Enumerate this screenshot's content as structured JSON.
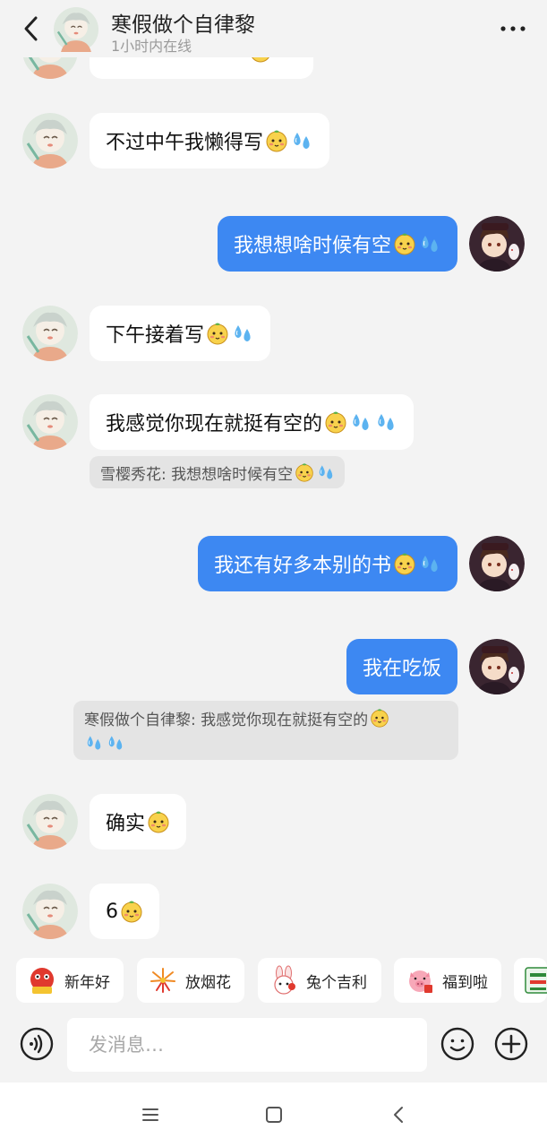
{
  "header": {
    "title": "寒假做个自律黎",
    "status": "1小时内在线"
  },
  "messages": [
    {
      "side": "in",
      "text": "",
      "emojis": [
        "face"
      ]
    },
    {
      "side": "in",
      "text": "不过中午我懒得写",
      "emojis": [
        "face",
        "sweat"
      ]
    },
    {
      "side": "out",
      "text": "我想想啥时候有空",
      "emojis": [
        "face",
        "sweat"
      ]
    },
    {
      "side": "in",
      "text": "下午接着写",
      "emojis": [
        "face",
        "sweat"
      ]
    },
    {
      "side": "in",
      "text": "我感觉你现在就挺有空的",
      "emojis": [
        "face",
        "sweat",
        "sweat"
      ]
    },
    {
      "side": "out",
      "text": "我还有好多本别的书",
      "emojis": [
        "face",
        "sweat"
      ]
    },
    {
      "side": "out",
      "text": "我在吃饭",
      "emojis": []
    },
    {
      "side": "in",
      "text": "确实",
      "emojis": [
        "face"
      ]
    },
    {
      "side": "in",
      "text": "6",
      "emojis": [
        "face"
      ]
    }
  ],
  "quotes": [
    {
      "text": "雪樱秀花: 我想想啥时候有空",
      "emojis": [
        "face",
        "sweat"
      ]
    },
    {
      "text": "寒假做个自律黎: 我感觉你现在就挺有空的",
      "emojis": [
        "face"
      ],
      "line2_emojis": [
        "sweat",
        "sweat"
      ]
    }
  ],
  "quick_replies": [
    {
      "label": "新年好",
      "icon": "lion-dance-icon"
    },
    {
      "label": "放烟花",
      "icon": "fireworks-icon"
    },
    {
      "label": "兔个吉利",
      "icon": "rabbit-icon"
    },
    {
      "label": "福到啦",
      "icon": "pig-icon"
    },
    {
      "label": "",
      "icon": "mahjong-icon"
    }
  ],
  "input": {
    "placeholder": "发消息…"
  },
  "colors": {
    "outgoing_bubble": "#3d88f2",
    "incoming_bubble": "#ffffff",
    "background": "#f3f3f3",
    "quote_background": "#e4e4e4"
  }
}
